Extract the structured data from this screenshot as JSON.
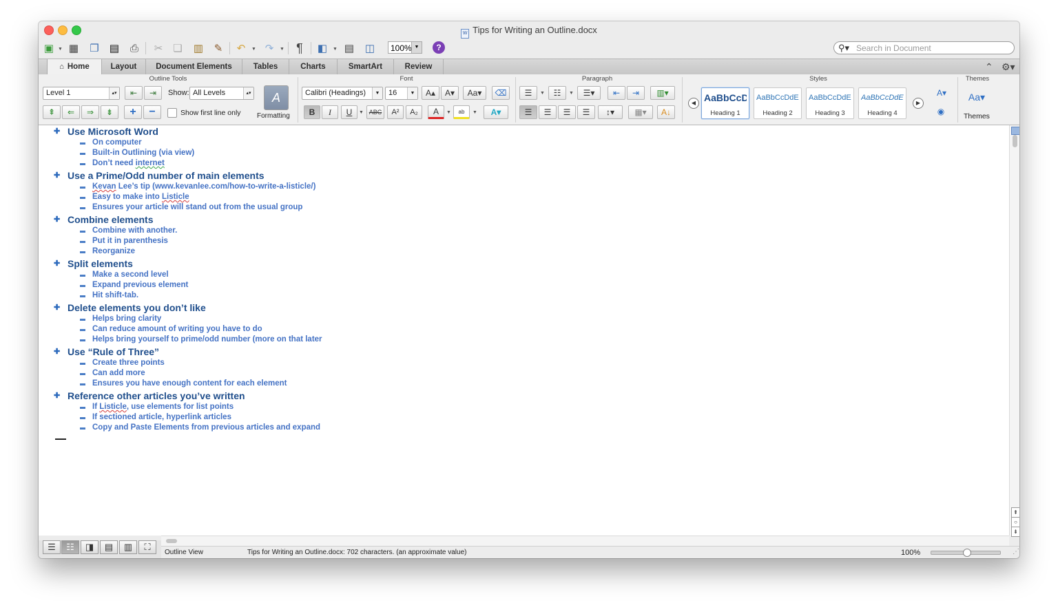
{
  "window": {
    "title": "Tips for Writing an Outline.docx"
  },
  "toolbar": {
    "zoom": "100%",
    "help": "?",
    "search_placeholder": "Search in Document",
    "paragraph_mark": "¶"
  },
  "tabs": [
    {
      "label": "Home",
      "active": true
    },
    {
      "label": "Layout"
    },
    {
      "label": "Document Elements"
    },
    {
      "label": "Tables"
    },
    {
      "label": "Charts"
    },
    {
      "label": "SmartArt"
    },
    {
      "label": "Review"
    }
  ],
  "ribbon": {
    "groups": {
      "outline_tools": "Outline Tools",
      "font": "Font",
      "paragraph": "Paragraph",
      "styles": "Styles",
      "themes": "Themes"
    },
    "outline_tools": {
      "level_value": "Level 1",
      "show_label": "Show:",
      "show_value": "All Levels",
      "first_line_label": "Show first line only",
      "formatting_label": "Formatting"
    },
    "font": {
      "name": "Calibri (Headings)",
      "size": "16",
      "bold": "B",
      "italic": "I",
      "underline": "U",
      "strike": "ABC"
    },
    "styles": [
      {
        "sample": "AaBbCcDdEe",
        "name": "Heading 1",
        "selected": true
      },
      {
        "sample": "AaBbCcDdEe",
        "name": "Heading 2"
      },
      {
        "sample": "AaBbCcDdEe",
        "name": "Heading 3"
      },
      {
        "sample": "AaBbCcDdEe",
        "name": "Heading 4"
      }
    ],
    "themes_label": "Themes"
  },
  "outline": [
    {
      "heading": "Use Microsoft Word",
      "items": [
        "On computer",
        "Built-in Outlining (via view)",
        "Don’t need internet"
      ]
    },
    {
      "heading": "Use a Prime/Odd number of main elements",
      "items": [
        "Kevan Lee’s tip (www.kevanlee.com/how-to-write-a-listicle/)",
        "Easy to make into Listicle",
        "Ensures your article will stand out from the usual group"
      ]
    },
    {
      "heading": "Combine elements",
      "items": [
        "Combine with another.",
        "Put it in parenthesis",
        "Reorganize"
      ]
    },
    {
      "heading": "Split elements",
      "items": [
        "Make a second level",
        "Expand previous element",
        "Hit shift-tab."
      ]
    },
    {
      "heading": "Delete elements you don’t like",
      "items": [
        "Helps bring clarity",
        "Can reduce amount of writing you have to do",
        "Helps bring yourself to prime/odd number (more on that later"
      ]
    },
    {
      "heading": "Use “Rule of Three”",
      "items": [
        "Create three points",
        "Can add more",
        "Ensures you have enough content for each element"
      ]
    },
    {
      "heading": "Reference other articles you’ve written",
      "items": [
        "If Listicle, use elements for list points",
        "If sectioned article, hyperlink articles",
        "Copy and Paste Elements from previous articles and expand"
      ]
    }
  ],
  "status": {
    "view": "Outline View",
    "info": "Tips for Writing an Outline.docx: 702 characters. (an approximate value)",
    "zoom": "100%"
  }
}
